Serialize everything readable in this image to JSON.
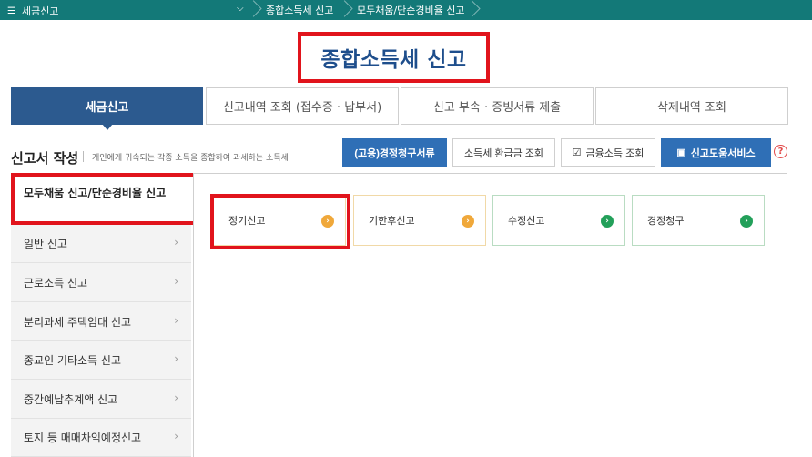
{
  "breadcrumb": {
    "menu_label": "세금신고",
    "crumbs": [
      "종합소득세 신고",
      "모두채움/단순경비율 신고"
    ]
  },
  "page_title": "종합소득세 신고",
  "tabs": [
    {
      "label": "세금신고",
      "active": true
    },
    {
      "label": "신고내역 조회 (접수증 · 납부서)",
      "active": false
    },
    {
      "label": "신고 부속 · 증빙서류 제출",
      "active": false
    },
    {
      "label": "삭제내역 조회",
      "active": false
    }
  ],
  "section": {
    "title": "신고서 작성",
    "description": "개인에게 귀속되는 각종 소득을 종합하여 과세하는 소득세"
  },
  "actions": [
    {
      "label": "(고용)경정청구서류"
    },
    {
      "label": "소득세 환급금 조회"
    },
    {
      "label": "금융소득 조회",
      "icon": "checkbox-icon"
    },
    {
      "label": "신고도움서비스",
      "icon": "book-icon"
    }
  ],
  "help_symbol": "?",
  "sidebar": {
    "active_item": "모두채움 신고/단순경비율 신고",
    "items": [
      {
        "label": "일반 신고"
      },
      {
        "label": "근로소득 신고"
      },
      {
        "label": "분리과세 주택임대 신고"
      },
      {
        "label": "종교인 기타소득 신고"
      },
      {
        "label": "중간예납추계액 신고"
      },
      {
        "label": "토지 등 매매차익예정신고"
      }
    ]
  },
  "cards": [
    {
      "label": "정기신고",
      "color": "#f0a83a"
    },
    {
      "label": "기한후신고",
      "color": "#f0a83a"
    },
    {
      "label": "수정신고",
      "color": "#23a05a"
    },
    {
      "label": "경정청구",
      "color": "#23a05a"
    }
  ],
  "colors": {
    "topbar": "#137978",
    "title": "#1e4e8c",
    "active_tab": "#2c5a8f",
    "primary_button": "#2f6fb6",
    "highlight": "#e1141c"
  }
}
